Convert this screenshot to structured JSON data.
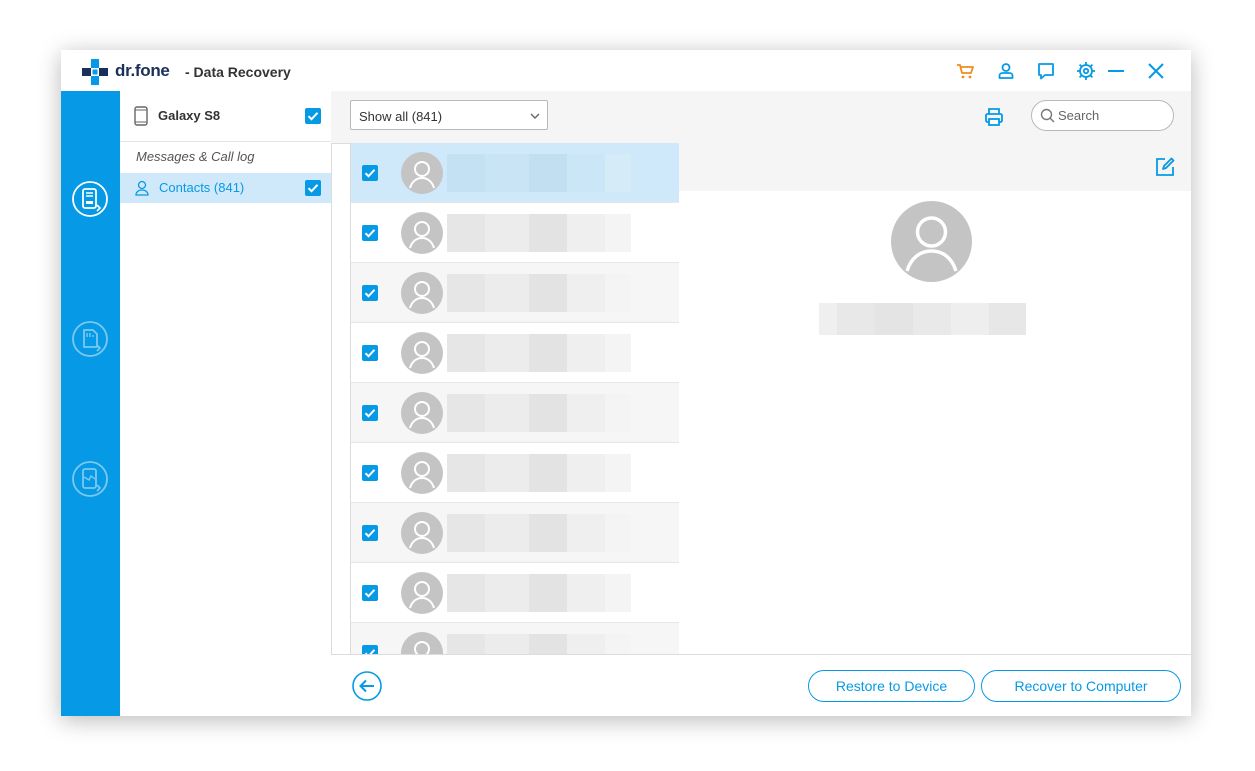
{
  "window": {
    "brand": "dr.fone",
    "subtitle": "- Data Recovery",
    "toolbar_icons": [
      "cart-icon",
      "user-icon",
      "feedback-icon",
      "settings-icon",
      "minimize-icon",
      "close-icon"
    ]
  },
  "rail": {
    "items": [
      {
        "icon": "phone-recovery-icon",
        "active": true
      },
      {
        "icon": "sd-card-recovery-icon",
        "active": false
      },
      {
        "icon": "broken-phone-recovery-icon",
        "active": false
      }
    ]
  },
  "sidebar": {
    "device_name": "Galaxy S8",
    "device_checked": true,
    "section_label": "Messages & Call log",
    "items": [
      {
        "label": "Contacts (841)",
        "checked": true,
        "selected": true
      }
    ]
  },
  "toolbar": {
    "filter_value": "Show all (841)",
    "search_placeholder": "Search"
  },
  "contact_list": {
    "rows": [
      {
        "checked": true,
        "selected": true
      },
      {
        "checked": true
      },
      {
        "checked": true
      },
      {
        "checked": true
      },
      {
        "checked": true
      },
      {
        "checked": true
      },
      {
        "checked": true
      },
      {
        "checked": true
      },
      {
        "checked": true
      }
    ]
  },
  "footer": {
    "restore_label": "Restore to Device",
    "recover_label": "Recover to Computer"
  },
  "colors": {
    "accent": "#069ae6",
    "rail": "#069ae6",
    "selected_row": "#cfe9fb",
    "cart_icon": "#f08c1e",
    "brand_text": "#1a2f5a"
  }
}
